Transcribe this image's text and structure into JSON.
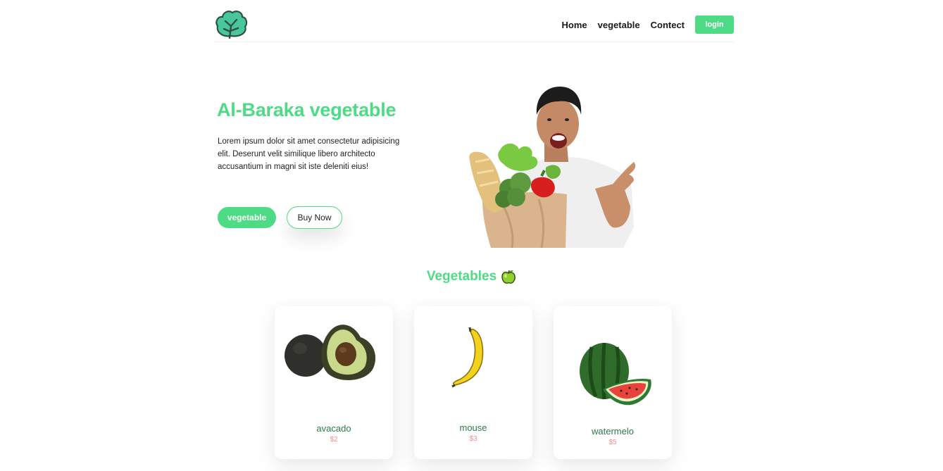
{
  "nav": {
    "logo": "leaf-logo-icon",
    "links": [
      "Home",
      "vegetable",
      "Contect"
    ],
    "login_label": "login"
  },
  "hero": {
    "title": "Al-Baraka vegetable",
    "description": "Lorem ipsum dolor sit amet consectetur adipisicing elit. Deserunt velit similique libero architecto accusantium in magni sit iste deleniti eius!",
    "primary_button": "vegetable",
    "secondary_button": "Buy Now",
    "image": "man-holding-grocery-bag-image"
  },
  "section": {
    "title": "Vegetables",
    "icon": "green-apple-icon"
  },
  "products": [
    {
      "name": "avacado",
      "price": "$2",
      "image": "avocado-image"
    },
    {
      "name": "mouse",
      "price": "$3",
      "image": "banana-image"
    },
    {
      "name": "watermelo",
      "price": "$5",
      "image": "watermelon-image"
    }
  ],
  "colors": {
    "accent": "#4ddc85",
    "product_name": "#2d7a4a",
    "price": "#f0928e"
  }
}
